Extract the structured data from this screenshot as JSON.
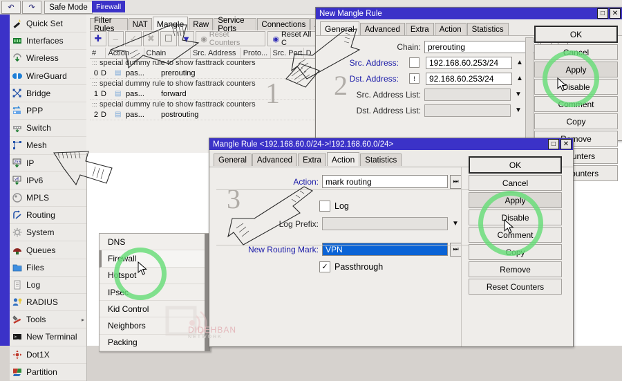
{
  "toolbar": {
    "undo_icon": "undo-icon",
    "redo_icon": "redo-icon",
    "safe_mode_label": "Safe Mode",
    "window_tab_label": "Firewall"
  },
  "sidebar": {
    "items": [
      {
        "label": "Quick Set",
        "icon": "wand-icon"
      },
      {
        "label": "Interfaces",
        "icon": "interfaces-icon"
      },
      {
        "label": "Wireless",
        "icon": "wireless-icon"
      },
      {
        "label": "WireGuard",
        "icon": "wireguard-icon"
      },
      {
        "label": "Bridge",
        "icon": "bridge-icon"
      },
      {
        "label": "PPP",
        "icon": "ppp-icon"
      },
      {
        "label": "Switch",
        "icon": "switch-icon"
      },
      {
        "label": "Mesh",
        "icon": "mesh-icon"
      },
      {
        "label": "IP",
        "icon": "ip-icon"
      },
      {
        "label": "IPv6",
        "icon": "ipv6-icon"
      },
      {
        "label": "MPLS",
        "icon": "mpls-icon"
      },
      {
        "label": "Routing",
        "icon": "routing-icon"
      },
      {
        "label": "System",
        "icon": "system-icon"
      },
      {
        "label": "Queues",
        "icon": "queues-icon"
      },
      {
        "label": "Files",
        "icon": "folder-icon"
      },
      {
        "label": "Log",
        "icon": "log-icon"
      },
      {
        "label": "RADIUS",
        "icon": "radius-icon"
      },
      {
        "label": "Tools",
        "icon": "tools-icon",
        "submenu_arrow": "▸"
      },
      {
        "label": "New Terminal",
        "icon": "terminal-icon"
      },
      {
        "label": "Dot1X",
        "icon": "dot1x-icon"
      },
      {
        "label": "Partition",
        "icon": "partition-icon"
      }
    ]
  },
  "ip_submenu": {
    "items": [
      {
        "label": "DNS"
      },
      {
        "label": "Firewall",
        "selected": true
      },
      {
        "label": "Hotspot"
      },
      {
        "label": "IPsec"
      },
      {
        "label": "Kid Control"
      },
      {
        "label": "Neighbors"
      },
      {
        "label": "Packing"
      }
    ]
  },
  "firewall_window": {
    "tabs": [
      {
        "label": "Filter Rules"
      },
      {
        "label": "NAT"
      },
      {
        "label": "Mangle",
        "active": true
      },
      {
        "label": "Raw"
      },
      {
        "label": "Service Ports"
      },
      {
        "label": "Connections"
      },
      {
        "label": "A"
      }
    ],
    "toolbar": {
      "add_icon": "plus-icon",
      "remove_icon": "minus-icon",
      "enable_icon": "check-icon",
      "disable_icon": "cross-icon",
      "comment_icon": "comment-icon",
      "filter_icon": "funnel-icon",
      "reset_counters_label": "Reset Counters",
      "reset_all_counters_label": "Reset All C",
      "reset_icon": "reset-icon"
    },
    "columns": [
      "#",
      "Action",
      "Chain",
      "Src. Address",
      "Proto...",
      "Src. Port",
      "D"
    ],
    "rows": [
      {
        "type": "comment",
        "text": "special dummy rule to show fasttrack counters"
      },
      {
        "type": "rule",
        "num": "0",
        "flag": "D",
        "action": "pas...",
        "chain": "prerouting"
      },
      {
        "type": "comment",
        "text": "special dummy rule to show fasttrack counters"
      },
      {
        "type": "rule",
        "num": "1",
        "flag": "D",
        "action": "pas...",
        "chain": "forward"
      },
      {
        "type": "comment",
        "text": "special dummy rule to show fasttrack counters"
      },
      {
        "type": "rule",
        "num": "2",
        "flag": "D",
        "action": "pas...",
        "chain": "postrouting"
      }
    ]
  },
  "new_mangle_rule": {
    "title": "New Mangle Rule",
    "maximize_icon": "maximize-icon",
    "close_icon": "close-icon",
    "tabs": [
      {
        "label": "General",
        "active": true
      },
      {
        "label": "Advanced"
      },
      {
        "label": "Extra"
      },
      {
        "label": "Action"
      },
      {
        "label": "Statistics"
      }
    ],
    "step_number": "2",
    "fields": {
      "chain_label": "Chain:",
      "chain_value": "prerouting",
      "src_address_label": "Src. Address:",
      "src_address_value": "192.168.60.253/24",
      "src_address_checked": false,
      "dst_address_label": "Dst. Address:",
      "dst_address_value": "92.168.60.253/24",
      "dst_address_checked": true,
      "src_address_list_label": "Src. Address List:",
      "src_address_list_value": "",
      "dst_address_list_label": "Dst. Address List:",
      "dst_address_list_value": ""
    },
    "buttons": [
      {
        "label": "OK",
        "primary": true
      },
      {
        "label": "Cancel"
      },
      {
        "label": "Apply",
        "highlighted": true
      },
      {
        "label": "Disable"
      },
      {
        "label": "Comment"
      },
      {
        "label": "Copy"
      },
      {
        "label": "Remove"
      },
      {
        "label": "t Counters"
      },
      {
        "label": "All Counters"
      }
    ]
  },
  "mangle_rule": {
    "title": "Mangle Rule <192.168.60.0/24->!192.168.60.0/24>",
    "maximize_icon": "maximize-icon",
    "close_icon": "close-icon",
    "tabs": [
      {
        "label": "General"
      },
      {
        "label": "Advanced"
      },
      {
        "label": "Extra"
      },
      {
        "label": "Action",
        "active": true
      },
      {
        "label": "Statistics"
      }
    ],
    "step_number": "3",
    "fields": {
      "action_label": "Action:",
      "action_value": "mark routing",
      "log_label": "Log",
      "log_checked": false,
      "log_prefix_label": "Log Prefix:",
      "log_prefix_value": "",
      "new_routing_mark_label": "New Routing Mark:",
      "new_routing_mark_value": "VPN",
      "passthrough_label": "Passthrough",
      "passthrough_checked": true
    },
    "buttons": [
      {
        "label": "OK",
        "primary": true
      },
      {
        "label": "Cancel"
      },
      {
        "label": "Apply",
        "highlighted": true
      },
      {
        "label": "Disable"
      },
      {
        "label": "Comment"
      },
      {
        "label": "Copy"
      },
      {
        "label": "Remove"
      },
      {
        "label": "Reset Counters"
      }
    ]
  },
  "annotations": {
    "step1": "1",
    "step2": "2",
    "step3": "3"
  },
  "watermark": {
    "text": "DIDEHBAN",
    "subtext": "NETWORK"
  },
  "colors": {
    "titlebar": "#3b32c8",
    "highlight_ring": "#66dd77",
    "selection": "#0a63d6",
    "label_blue": "#1a1aa8"
  }
}
